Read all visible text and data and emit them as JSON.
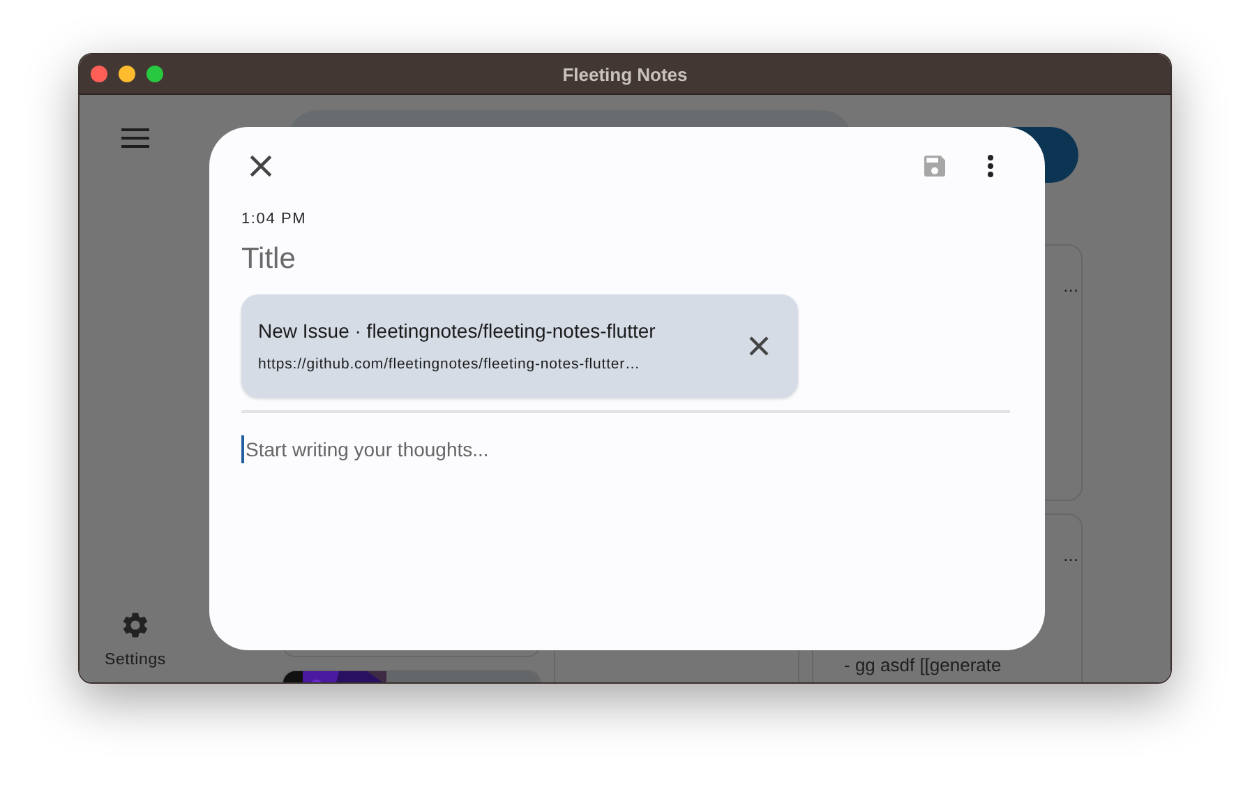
{
  "window": {
    "title": "Fleeting Notes",
    "traffic_lights": [
      {
        "color": "#ff5f57"
      },
      {
        "color": "#febc2e"
      },
      {
        "color": "#28c840"
      }
    ]
  },
  "sidebar": {
    "settings_label": "Settings"
  },
  "notes": [
    {
      "lines": [
        "..."
      ]
    },
    {
      "lines": [
        "...",
        "- gg asdf [[generate"
      ]
    }
  ],
  "dialog": {
    "time": "1:04 PM",
    "title_placeholder": "Title",
    "link_preview": {
      "title": "New Issue · fleetingnotes/fleeting-notes-flutter",
      "url": "https://github.com/fleetingnotes/fleeting-notes-flutter…"
    },
    "body_placeholder": "Start writing your thoughts...",
    "save_disabled": true
  }
}
